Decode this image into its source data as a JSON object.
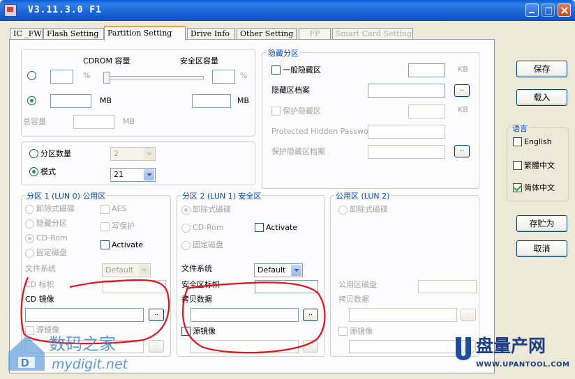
{
  "window": {
    "title": "V3.11.3.0 F1"
  },
  "tabs": [
    {
      "label": "IC _FW"
    },
    {
      "label": "Flash Setting"
    },
    {
      "label": "Partition Setting"
    },
    {
      "label": "Drive Info"
    },
    {
      "label": "Other Setting"
    },
    {
      "label": "FP"
    },
    {
      "label": "Smart Card Setting"
    }
  ],
  "capacity": {
    "cdrom_label": "CDROM 容量",
    "secure_label": "安全区容量",
    "percent_unit": "%",
    "mb_unit": "MB",
    "total_label": "总容量",
    "total_unit": "MB",
    "percent_slider_value": 0
  },
  "partition_mode": {
    "count_label": "分区数量",
    "count_value": "2",
    "mode_label": "模式",
    "mode_value": "21"
  },
  "hidden": {
    "title": "隐藏分区",
    "general_label": "一般隐藏区",
    "kb_unit": "KB",
    "file_label": "隐藏区档案",
    "protect_label": "保护隐藏区",
    "password_label": "Protected Hidden Password",
    "protect_file_label": "保护隐藏区档案",
    "browse": ".."
  },
  "part1": {
    "title": "分区 1 (LUN 0) 公用区",
    "removable": "卸除式磁碟",
    "hidden": "隐藏分区",
    "cdrom": "CD-Rom",
    "fixed": "固定磁盘",
    "aes": "AES",
    "write_protect": "写保护",
    "activate": "Activate",
    "fs_label": "文件系统",
    "fs_value": "Default",
    "vol_label": "CD 标帜",
    "image_label": "CD 镜像",
    "source_label": "源镜像",
    "browse": ".."
  },
  "part2": {
    "title": "分区 2 (LUN 1) 安全区",
    "removable": "卸除式磁碟",
    "cdrom": "CD-Rom",
    "fixed": "固定磁盘",
    "activate": "Activate",
    "fs_label": "文件系统",
    "fs_value": "Default",
    "vol_label": "安全区标帜",
    "copy_label": "拷贝数据",
    "source_label": "源镜像",
    "browse": ".."
  },
  "public": {
    "title": "公用区 (LUN 2)",
    "removable": "卸除式磁碟",
    "vol_label": "公用区磁盘",
    "copy_label": "拷贝数据",
    "source_label": "源镜像",
    "browse": ".."
  },
  "buttons": {
    "save": "保存",
    "load": "载入",
    "save_as": "存贮为",
    "cancel": "取消"
  },
  "language": {
    "title": "语言",
    "options": [
      "English",
      "繁體中文",
      "简体中文"
    ]
  },
  "watermarks": {
    "left_cn": "数码之家",
    "left_en": "mydigit.net",
    "right_cn": "盘量产网",
    "right_en": "WWW.UPANTOOL.COM"
  },
  "colors": {
    "title_bar": "#1c64d8",
    "group_label": "#0046d5",
    "scribble": "#e8101a",
    "check_green": "#21a121"
  }
}
